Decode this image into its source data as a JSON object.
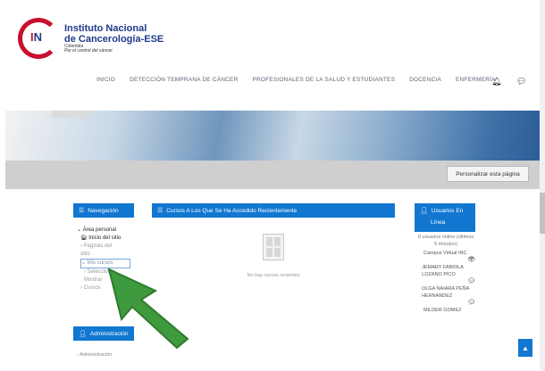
{
  "logo": {
    "line1": "Instituto Nacional",
    "line2": "de Cancerología-ESE",
    "line3": "Colombia",
    "line4": "Por el control del cáncer"
  },
  "nav": {
    "items": [
      "INICIO",
      "DETECCIÓN TEMPRANA DE CÁNCER",
      "PROFESIONALES DE LA SALUD Y ESTUDIANTES",
      "DOCENCIA",
      "ENFERMERÍA"
    ],
    "icons": [
      "bell-icon",
      "chat-icon"
    ]
  },
  "page": {
    "customize_label": "Personalizar esta página"
  },
  "navigation_block": {
    "title": "Navegación",
    "items": [
      "Área personal",
      "Inicio del sitio",
      "Páginas del",
      "sitio",
      "Mis cursos",
      "Seleccionar",
      "Mostrar",
      "Cursos"
    ]
  },
  "courses_block": {
    "title": "Cursos A Los Que Se Ha Accedido Recientemente",
    "empty_message": "No hay cursos recientes"
  },
  "users_block": {
    "title_line1": "Usuarios En",
    "title_line2": "Línea",
    "summary": "8 usuarios online (últimos 5 minutos)",
    "entries": [
      "Campus Virtual INC",
      "JEMARY FABIOLA LOZANO PICO",
      "OLGA NAIARA PEÑA HERNANDEZ",
      "MILDER GOMEZ"
    ]
  },
  "admin_block": {
    "title": "Administración",
    "item": "Administración"
  },
  "colors": {
    "accent": "#1177d1",
    "brand_red": "#c8102e",
    "brand_blue": "#1f3a8a",
    "cursor_green": "#3e9a3c"
  }
}
